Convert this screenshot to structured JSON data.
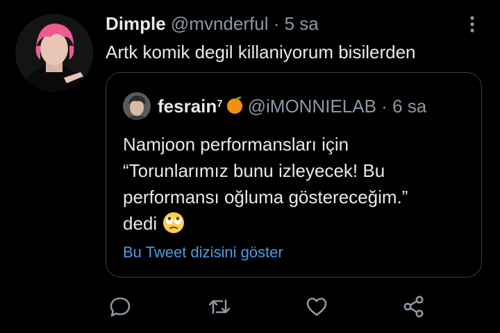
{
  "tweet": {
    "display_name": "Dimple",
    "handle": "@mvnderful",
    "separator": "·",
    "time": "5 sa",
    "text": "Artk komik degil killaniyorum bisilerden"
  },
  "quoted": {
    "display_name": "fesrain",
    "name_sup": "7",
    "handle": "@iMONNIELAB",
    "separator": "·",
    "time": "6 sa",
    "lines": [
      "Namjoon performansları için",
      "“Torunlarımız bunu izleyecek! Bu",
      "performansı oğluma göstereceğim.”",
      "dedi"
    ],
    "emoji": "rolling-eyes-emoji",
    "thread_link": "Bu Tweet dizisini göster"
  },
  "icons": [
    "more-vertical-icon",
    "reply-icon",
    "retweet-icon",
    "like-icon",
    "share-icon"
  ],
  "colors": {
    "background": "#000000",
    "text": "#e7e9ea",
    "muted": "#8b98a5",
    "link": "#4a9be8",
    "border": "#3a3f44"
  }
}
